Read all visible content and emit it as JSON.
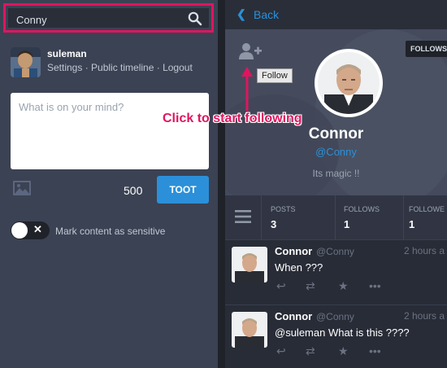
{
  "compose": {
    "search_value": "Conny",
    "user": {
      "name": "suleman",
      "links": [
        "Settings",
        "Public timeline",
        "Logout"
      ]
    },
    "textarea_placeholder": "What is on your mind?",
    "char_count": "500",
    "toot_label": "TOOT",
    "sensitive_label": "Mark content as sensitive",
    "sensitive_on": false
  },
  "profile": {
    "back_label": "Back",
    "follows_badge": "FOLLOWS",
    "follow_tooltip": "Follow",
    "display_name": "Connor",
    "handle": "@Conny",
    "bio": "Its magic !!",
    "stats": [
      {
        "label": "POSTS",
        "value": "3"
      },
      {
        "label": "FOLLOWS",
        "value": "1"
      },
      {
        "label": "FOLLOWE",
        "value": "1"
      }
    ]
  },
  "annotation": {
    "text": "Click to start following",
    "color": "#e0155f"
  },
  "statuses": [
    {
      "name": "Connor",
      "handle": "@Conny",
      "time": "2 hours a",
      "body": "When ???"
    },
    {
      "name": "Connor",
      "handle": "@Conny",
      "time": "2 hours a",
      "body": "@suleman What is this ????"
    }
  ],
  "colors": {
    "accent": "#2b90d9",
    "panel": "#3b4253",
    "background": "#282c37",
    "highlight": "#e0155f"
  },
  "icons": [
    "search-icon",
    "image-icon",
    "close-icon",
    "chevron-left-icon",
    "person-add-icon",
    "hamburger-icon",
    "reply-icon",
    "boost-icon",
    "star-icon",
    "more-icon"
  ]
}
